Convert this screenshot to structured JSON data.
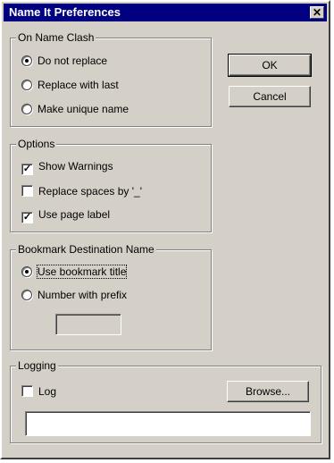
{
  "window": {
    "title": "Name It Preferences",
    "close_glyph": "✕"
  },
  "on_name_clash": {
    "label": "On Name Clash",
    "options": [
      "Do not replace",
      "Replace with last",
      "Make unique name"
    ],
    "selected": "Do not replace"
  },
  "options": {
    "label": "Options",
    "items": [
      {
        "label": "Show Warnings",
        "checked": true
      },
      {
        "label": "Replace spaces by '_'",
        "checked": false
      },
      {
        "label": "Use page label",
        "checked": true
      }
    ],
    "check_glyph": "✓"
  },
  "bookmark": {
    "label": "Bookmark Destination Name",
    "options": [
      "Use bookmark title",
      "Number with prefix"
    ],
    "selected": "Use bookmark title",
    "prefix_value": ""
  },
  "logging": {
    "label": "Logging",
    "log_label": "Log",
    "log_checked": false,
    "browse_label": "Browse...",
    "path_value": ""
  },
  "buttons": {
    "ok": "OK",
    "cancel": "Cancel"
  }
}
